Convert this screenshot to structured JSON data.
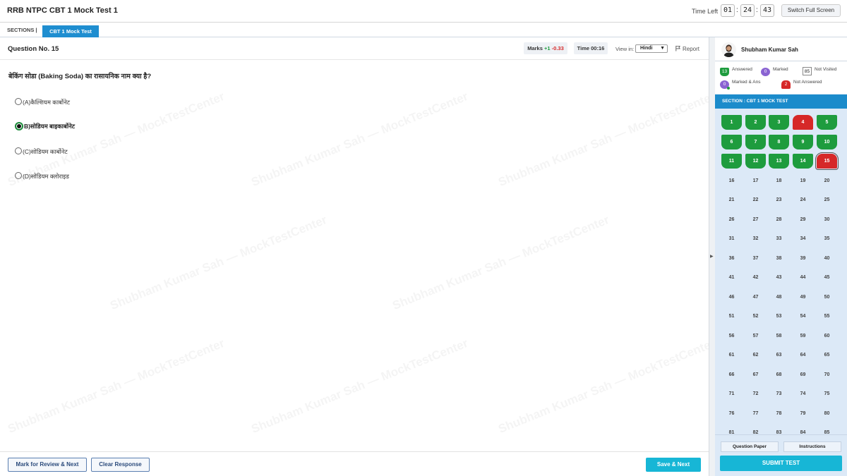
{
  "header": {
    "title": "RRB NTPC CBT 1 Mock Test 1",
    "time_left_label": "Time Left",
    "time_hours": "01",
    "time_minutes": "24",
    "time_seconds": "43",
    "fullscreen_label": "Switch Full Screen"
  },
  "sections": {
    "label": "SECTIONS |",
    "active_tab": "CBT 1 Mock Test"
  },
  "question": {
    "number_label": "Question No. 15",
    "marks_label": "Marks",
    "marks_positive": "+1",
    "marks_negative": "-0.33",
    "time_label": "Time 00:16",
    "view_in_label": "View in:",
    "language": "Hindi",
    "report_label": "Report",
    "text": "बेकिंग सोडा (Baking Soda) का रासायनिक नाम क्या है?",
    "options": [
      {
        "label": "(A)कैल्शियम कार्बोनेट",
        "selected": false
      },
      {
        "label": "B)सोडियम बाइकार्बोनेट",
        "selected": true
      },
      {
        "label": "(C)सोडियम कार्बोनेट",
        "selected": false
      },
      {
        "label": "(D)सोडियम क्लोराइड",
        "selected": false
      }
    ]
  },
  "watermark_text": "Shubham Kumar Sah — MockTestCenter",
  "footer": {
    "mark_review_label": "Mark for Review & Next",
    "clear_label": "Clear Response",
    "save_next_label": "Save & Next"
  },
  "profile": {
    "name": "Shubham Kumar Sah"
  },
  "legend": {
    "answered_count": "13",
    "answered_label": "Answered",
    "marked_count": "0",
    "marked_label": "Marked",
    "not_visited_count": "85",
    "not_visited_label": "Not Visited",
    "marked_answered_count": "0",
    "marked_answered_label": "Marked & Ans",
    "not_answered_count": "2",
    "not_answered_label": "Not Answered"
  },
  "palette": {
    "section_heading": "SECTION : CBT 1 MOCK TEST",
    "total_visible": 85,
    "answered": [
      1,
      2,
      3,
      5,
      6,
      7,
      8,
      9,
      10,
      11,
      12,
      13,
      14
    ],
    "not_answered": [
      4,
      15
    ],
    "current": 15
  },
  "panel_footer": {
    "question_paper_label": "Question Paper",
    "instructions_label": "Instructions",
    "submit_label": "SUBMIT TEST"
  },
  "colors": {
    "answered": "#1e9c3e",
    "not_answered": "#d62828",
    "marked": "#8a63d2",
    "accent": "#1b8bcb",
    "action": "#17b6d6"
  }
}
